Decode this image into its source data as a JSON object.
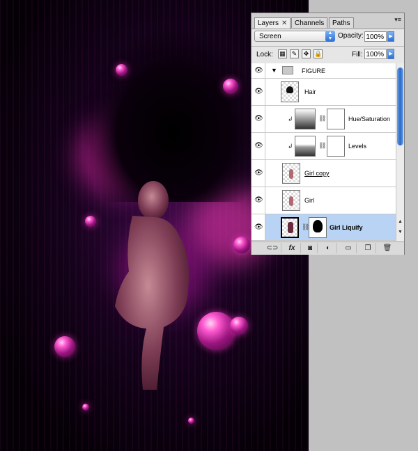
{
  "panel": {
    "tabs": [
      {
        "label": "Layers",
        "close": "✕",
        "active": true
      },
      {
        "label": "Channels",
        "active": false
      },
      {
        "label": "Paths",
        "active": false
      }
    ],
    "menu_icon": "panel-menu-icon",
    "blend_mode": "Screen",
    "opacity_label": "Opacity:",
    "opacity_value": "100%",
    "lock_label": "Lock:",
    "fill_label": "Fill:",
    "fill_value": "100%",
    "lock_icons": [
      "lock-transparent-icon",
      "lock-image-icon",
      "lock-position-icon",
      "lock-all-icon"
    ],
    "layers": [
      {
        "name": "FIGURE",
        "type": "group",
        "visible": true
      },
      {
        "name": "Hair",
        "type": "layer",
        "visible": true
      },
      {
        "name": "Hue/Saturation",
        "type": "adjustment",
        "visible": true,
        "clipped": true
      },
      {
        "name": "Levels",
        "type": "adjustment",
        "visible": true,
        "clipped": true
      },
      {
        "name": "Girl copy",
        "type": "layer",
        "visible": true
      },
      {
        "name": "Girl",
        "type": "layer",
        "visible": true
      },
      {
        "name": "Girl Liquify",
        "type": "layer-with-mask",
        "visible": true,
        "selected": true
      }
    ],
    "bottom_buttons": [
      "link-layers-icon",
      "fx-icon",
      "add-mask-icon",
      "adjustment-layer-icon",
      "new-group-icon",
      "new-layer-icon",
      "trash-icon"
    ],
    "bottom_labels": {
      "link": "⊂⊃",
      "fx": "fx",
      "mask": "◙",
      "adj": "◐",
      "group": "▭",
      "new": "❐",
      "trash": "🗑"
    }
  },
  "colors": {
    "selection": "#b8d3f3",
    "accent": "#2a6fd6",
    "artwork_glow": "#ff3fbf"
  }
}
